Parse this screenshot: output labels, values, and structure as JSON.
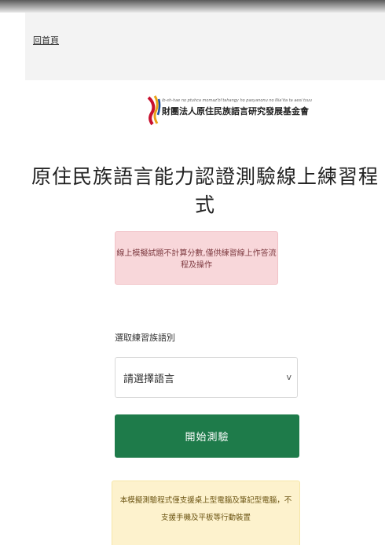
{
  "header": {
    "home_link": "回首頁"
  },
  "logo": {
    "tagline": "ib-sh-hae no ptuhca momaz'bi'tahangy ho pasyanonu no Nia'ita ta aesi tsuu",
    "organization": "財團法人原住民族語言研究發展基金會"
  },
  "main": {
    "title": "原住民族語言能力認證測驗線上練習程式",
    "notice": "線上模擬試題不計算分數,僅供練習線上作答流程及操作",
    "language_label": "選取練習族語別",
    "language_select": {
      "selected": "請選擇語言"
    },
    "start_button": "開始測驗",
    "support_notice": "本模擬測驗程式僅支援桌上型電腦及筆記型電腦，不支援手機及平板等行動裝置"
  },
  "colors": {
    "start_button": "#1e7b4a",
    "danger_bg": "#f8d7da",
    "warning_bg": "#fdf2cd",
    "logo_red": "#c8102e",
    "logo_gold": "#e8a317",
    "logo_blue": "#1b4f9c"
  },
  "icons": {
    "chevron": "chevron-down-icon",
    "logo": "foundation-logo-icon"
  }
}
